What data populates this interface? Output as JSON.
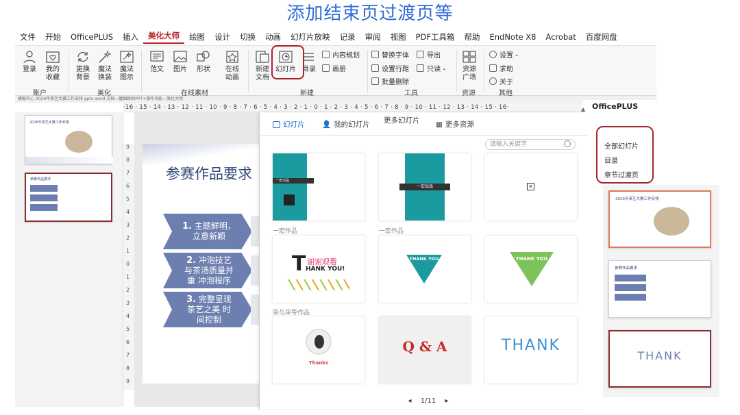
{
  "caption": "添加结束页过渡页等",
  "tabs": [
    "文件",
    "开始",
    "OfficePLUS",
    "插入",
    "美化大师",
    "绘图",
    "设计",
    "切换",
    "动画",
    "幻灯片放映",
    "记录",
    "审阅",
    "视图",
    "PDF工具箱",
    "帮助",
    "EndNote X8",
    "Acrobat",
    "百度网盘"
  ],
  "active_tab_index": 4,
  "ribbon": {
    "login": "登录",
    "favorites": "我的\n收藏",
    "change_bg": "更换\n背景",
    "magic_change": "魔法\n换装",
    "magic_diagram": "魔法\n图示",
    "template": "范文",
    "picture": "图片",
    "shape": "形状",
    "online_anim": "在线\n动画",
    "new_doc": "新建\n文档",
    "slides": "幻灯片",
    "toc": "目录",
    "content_plan": "内容规划",
    "gallery": "画册",
    "replace_font": "替换字体",
    "export": "导出",
    "line_spacing": "设置行距",
    "read_only": "只读",
    "batch_delete": "批量删除",
    "resource_plaza": "资源\n广场",
    "settings": "设置",
    "help": "求助",
    "about": "关于",
    "groups": {
      "account": "账户",
      "beautify": "美化",
      "online": "在线素材",
      "new": "新建",
      "tools": "工具",
      "resource": "资源",
      "other": "其他"
    }
  },
  "doc_bar": "模板中心   2026年茶艺大赛工作安排.pptx   word 文档—罐细致的PPT+操作功能—美化大师",
  "ruler_text": "·16 · 15 · 14 · 13 · 12 · 11 · 10 · 9 · 8 · 7 · 6 · 5 · 4 · 3 · 2 · 1 · 0 · 1 · 2 · 3 · 4 · 5 · 6 · 7 · 8 · 9 · 10 · 11 · 12 · 13 · 14 · 15 · 16·",
  "officeplus_title": "OfficePLUS",
  "vruler": [
    "9",
    "8",
    "7",
    "6",
    "5",
    "4",
    "3",
    "2",
    "1",
    "0",
    "1",
    "2",
    "3",
    "4",
    "5",
    "6",
    "7",
    "8",
    "9"
  ],
  "slide": {
    "title": "参赛作品要求",
    "items": [
      {
        "num": "1.",
        "text": "主题鲜明，\n立意新颖"
      },
      {
        "num": "2.",
        "text": "冲泡技艺\n与茶汤质量并\n重 冲泡程序"
      },
      {
        "num": "3.",
        "text": "完整呈现\n茶艺之美 时\n间控制"
      }
    ]
  },
  "thumb1_title": "2026年茶艺大赛工作安排",
  "thumb2_title": "参赛作品要求",
  "panel": {
    "tabs": [
      "幻灯片",
      "我的幻灯片",
      "更多幻灯片",
      "更多资源"
    ],
    "search_placeholder": "请输入关键字",
    "section_labels": [
      "一宏作品",
      "一宏作品",
      "柒与柒导作品"
    ],
    "cards": [
      {
        "name": "card-business-teal",
        "text": "一宏出品"
      },
      {
        "name": "card-teal-band",
        "text": "一宏出品"
      },
      {
        "name": "card-broken-image",
        "text": ""
      },
      {
        "name": "card-thank-you-text",
        "text": "谢谢观看",
        "sub": "HANK YOU!",
        "big": "T"
      },
      {
        "name": "card-thank-you-triangle-teal",
        "text": "THANK YOU"
      },
      {
        "name": "card-thank-you-triangle-green",
        "text": "THANK YOU"
      },
      {
        "name": "card-thanks-avatar",
        "text": "Thanks"
      },
      {
        "name": "card-qa",
        "text": "Q & A"
      },
      {
        "name": "card-thank-blue",
        "text": "THANK"
      }
    ],
    "pager": "1/11"
  },
  "menu": [
    "全部幻灯片",
    "目录",
    "章节过渡页"
  ],
  "right_thumbs": [
    {
      "title": "2026年茶艺大赛工作安排"
    },
    {
      "title": "参赛作品要求"
    },
    {
      "title": "THANK"
    }
  ],
  "colors": {
    "accent": "#b7222a",
    "caption": "#2f6bd6",
    "slide_arrow": "#6d7fb0",
    "teal": "#1b9aa0"
  }
}
